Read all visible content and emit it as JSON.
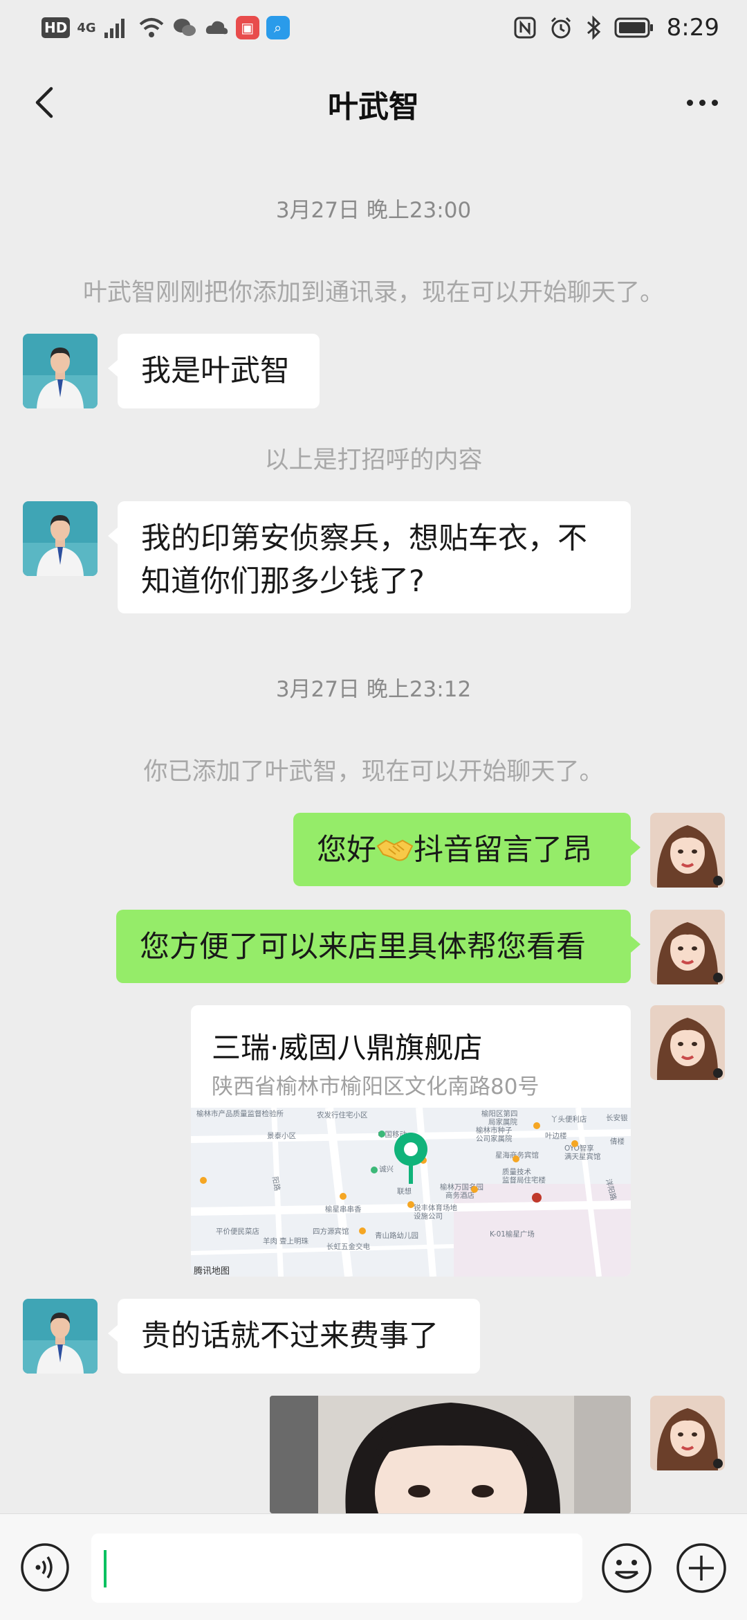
{
  "status_bar": {
    "hd": "HD",
    "network": "4G",
    "time": "8:29",
    "left_icons": [
      "signal-icon",
      "wifi-icon",
      "wechat-icon",
      "cloud-icon",
      "red-app-icon",
      "blue-app-icon"
    ],
    "right_icons": [
      "nfc-icon",
      "alarm-icon",
      "bluetooth-icon",
      "battery-icon"
    ]
  },
  "header": {
    "title": "叶武智"
  },
  "messages": {
    "ts1": "3月27日 晚上23:00",
    "sys1": "叶武智刚刚把你添加到通讯录，现在可以开始聊天了。",
    "m1": "我是叶武智",
    "sys2": "以上是打招呼的内容",
    "m2_line1": "我的印第安侦察兵，想贴车衣，不",
    "m2_line2": "知道你们那多少钱了?",
    "ts2": "3月27日 晚上23:12",
    "sys3": "你已添加了叶武智，现在可以开始聊天了。",
    "m3_before": "您好",
    "m3_after": "抖音留言了昂",
    "m4": "您方便了可以来店里具体帮您看看",
    "location": {
      "name": "三瑞·威固八鼎旗舰店",
      "address": "陕西省榆林市榆阳区文化南路80号",
      "map_labels": [
        "榆林市产品质量监督检验所",
        "农发行住宅小区",
        "榆阳区第四",
        "局家属院",
        "丫头便利店",
        "长安银",
        "景泰小区",
        "中国移动",
        "榆林市种子",
        "公司家属院",
        "叶边楼",
        "倩楼",
        "诚兴",
        "星海商务宾馆",
        "OYO智享",
        "满天星宾馆",
        "质量技术",
        "监督局住宅楼",
        "联想",
        "榆林万国名园",
        "商务酒店",
        "榆星串串香",
        "锐丰体育场地",
        "设施公司",
        "平价便民菜店",
        "四方源宾馆",
        "青山路幼儿园",
        "K-01榆星广场",
        "腾讯地图",
        "羊肉",
        "壹上明珠",
        "长虹五金交电",
        "阳路",
        "洋阳路"
      ]
    },
    "m5": "贵的话就不过来费事了"
  },
  "input_bar": {
    "placeholder": "",
    "voice_icon": "voice-icon",
    "emoji_icon": "emoji-icon",
    "plus_icon": "plus-icon"
  },
  "colors": {
    "background": "#ededed",
    "bubble_self": "#95ec69",
    "bubble_other": "#ffffff",
    "accent": "#07c160"
  }
}
